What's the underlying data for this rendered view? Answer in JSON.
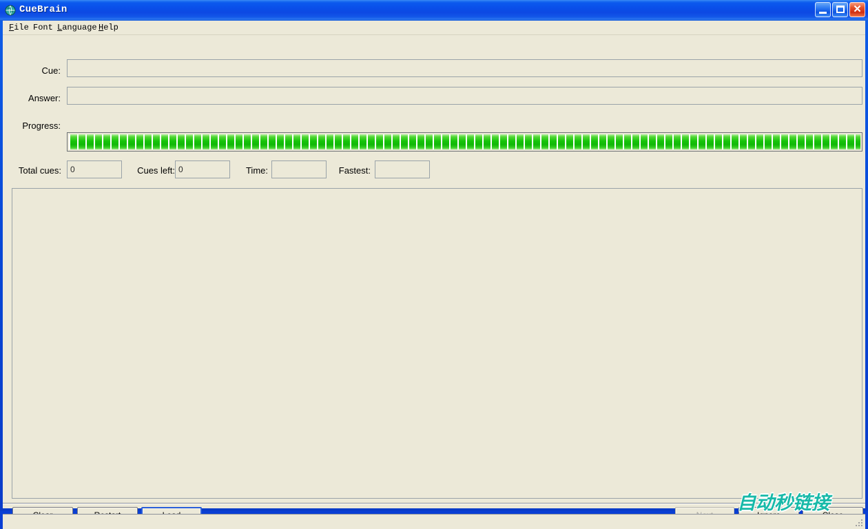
{
  "window": {
    "title": "CueBrain",
    "icon": "globe-icon",
    "controls": {
      "minimize_label": "Minimize",
      "maximize_label": "Maximize",
      "close_label": "Close"
    },
    "colors": {
      "titlebar_blue": "#0a4ee9",
      "face": "#ece9d8",
      "field_border": "#9aa3a8",
      "progress_green": "#17c40a",
      "focus_blue": "#2b5fd9",
      "watermark_teal": "#17b9a8"
    }
  },
  "menubar": {
    "items": [
      {
        "label": "File",
        "accel": "F"
      },
      {
        "label": "Font",
        "accel": "F"
      },
      {
        "label": "Language",
        "accel": "L"
      },
      {
        "label": "Help",
        "accel": "H"
      }
    ]
  },
  "form": {
    "cue": {
      "label": "Cue:",
      "value": "",
      "placeholder": ""
    },
    "answer": {
      "label": "Answer:",
      "value": "",
      "placeholder": ""
    },
    "progress": {
      "label": "Progress:",
      "percent": 100
    },
    "stats": {
      "total_cues": {
        "label": "Total cues:",
        "value": "0"
      },
      "cues_left": {
        "label": "Cues left:",
        "value": "0"
      },
      "time": {
        "label": "Time:",
        "value": ""
      },
      "fastest": {
        "label": "Fastest:",
        "value": ""
      }
    }
  },
  "content": {
    "text": ""
  },
  "buttons": {
    "clear": {
      "label": "Clear",
      "accel": "C",
      "enabled": true,
      "focused": false
    },
    "restart": {
      "label": "Restart",
      "accel": "R",
      "enabled": true,
      "focused": false
    },
    "load": {
      "label": "Load",
      "accel": "L",
      "enabled": true,
      "focused": true
    },
    "next": {
      "label": "Next",
      "accel": "N",
      "enabled": false,
      "focused": false
    },
    "ignore": {
      "label": "Ignore",
      "accel": "I",
      "enabled": true,
      "focused": false
    },
    "close": {
      "label": "Close",
      "accel": "C",
      "enabled": true,
      "focused": false
    }
  },
  "statusbar": {
    "text": ""
  },
  "watermark": {
    "text": "自动秒链接"
  }
}
